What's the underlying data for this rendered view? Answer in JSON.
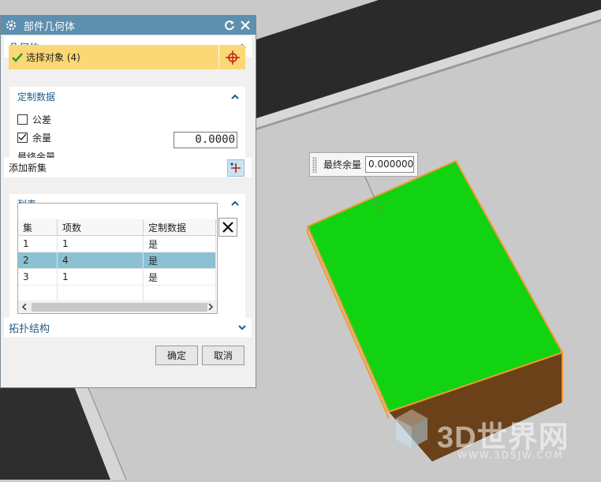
{
  "dialog": {
    "title": "部件几何体",
    "geometry_section": "几何体",
    "select_object_label": "选择对象 (4)",
    "custom_data_section": "定制数据",
    "tolerance_label": "公差",
    "tolerance_checked": false,
    "stock_label": "余量",
    "stock_checked": true,
    "final_stock_label": "最终余量",
    "final_stock_value": "0.0000",
    "add_new_set_label": "添加新集",
    "list_section": "列表",
    "list_columns": [
      "集",
      "项数",
      "定制数据"
    ],
    "list_rows": [
      {
        "set": "1",
        "count": "1",
        "custom": "是",
        "selected": false
      },
      {
        "set": "2",
        "count": "4",
        "custom": "是",
        "selected": true
      },
      {
        "set": "3",
        "count": "1",
        "custom": "是",
        "selected": false
      }
    ],
    "topology_section": "拓扑结构",
    "ok_label": "确定",
    "cancel_label": "取消"
  },
  "viewport": {
    "float_label": "最终余量",
    "float_value": "0.0000000"
  },
  "watermark": {
    "brand": "3D世界网",
    "url": "WWW.3DSJW.COM"
  },
  "colors": {
    "title_bar": "#5d8fae",
    "select_highlight": "#fbd875",
    "row_selected": "#8bc1d2",
    "box_top": "#12d312",
    "box_side": "#7a4a1f",
    "edge_highlight": "#f29a2e"
  }
}
